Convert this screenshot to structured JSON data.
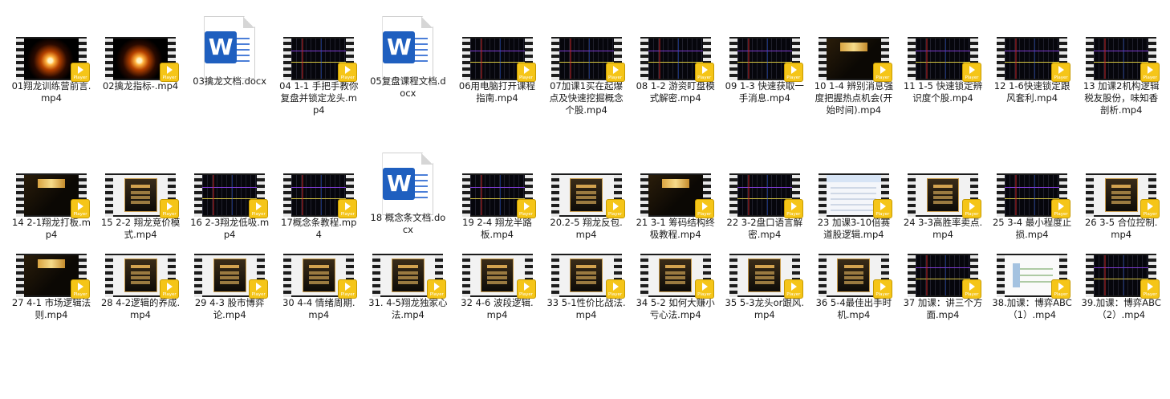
{
  "items": [
    {
      "label": "01翔龙训练营前言.mp4",
      "kind": "video",
      "thumb": "fire"
    },
    {
      "label": "02擒龙指标-.mp4",
      "kind": "video",
      "thumb": "fire"
    },
    {
      "label": "03擒龙文档.docx",
      "kind": "doc",
      "thumb": "word-icon"
    },
    {
      "label": "04 1-1 手把手教你复盘并锁定龙头.mp4",
      "kind": "video",
      "thumb": "chart"
    },
    {
      "label": "05复盘课程文档.docx",
      "kind": "doc",
      "thumb": "word-icon"
    },
    {
      "label": "06用电脑打开课程指南.mp4",
      "kind": "video",
      "thumb": "chart"
    },
    {
      "label": "07加课1买在起爆点及快速挖掘概念个股.mp4",
      "kind": "video",
      "thumb": "chart"
    },
    {
      "label": "08 1-2 游资盯盘模式解密.mp4",
      "kind": "video",
      "thumb": "chart"
    },
    {
      "label": "09 1-3 快速获取一手消息.mp4",
      "kind": "video",
      "thumb": "chart"
    },
    {
      "label": "10 1-4 辨别消息强度把握热点机会(开始时间).mp4",
      "kind": "video",
      "thumb": "cover"
    },
    {
      "label": "11 1-5 快速锁定辨识度个股.mp4",
      "kind": "video",
      "thumb": "chart"
    },
    {
      "label": "12 1-6快速锁定跟风套利.mp4",
      "kind": "video",
      "thumb": "chart"
    },
    {
      "label": "13 加课2机构逻辑税友股份，味知香剖析.mp4",
      "kind": "video",
      "thumb": "chart"
    },
    {
      "label": "14 2-1翔龙打板.mp4",
      "kind": "video",
      "thumb": "cover"
    },
    {
      "label": "15 2-2 翔龙竞价模式.mp4",
      "kind": "video",
      "thumb": "slide"
    },
    {
      "label": "16 2-3翔龙低吸.mp4",
      "kind": "video",
      "thumb": "chart"
    },
    {
      "label": "17概念条教程.mp4",
      "kind": "video",
      "thumb": "chart"
    },
    {
      "label": "18 概念条文档.docx",
      "kind": "doc",
      "thumb": "word-icon"
    },
    {
      "label": "19 2-4 翔龙半路板.mp4",
      "kind": "video",
      "thumb": "chart"
    },
    {
      "label": "20.2-5 翔龙反包.mp4",
      "kind": "video",
      "thumb": "slide"
    },
    {
      "label": "21 3-1 筹码结构终极教程.mp4",
      "kind": "video",
      "thumb": "cover"
    },
    {
      "label": "22 3-2盘口语言解密.mp4",
      "kind": "video",
      "thumb": "chart"
    },
    {
      "label": "23 加课3-10倍赛道股逻辑.mp4",
      "kind": "video",
      "thumb": "ui"
    },
    {
      "label": "24 3-3高胜率卖点.mp4",
      "kind": "video",
      "thumb": "slide"
    },
    {
      "label": "25 3-4 最小程度止损.mp4",
      "kind": "video",
      "thumb": "chart"
    },
    {
      "label": "26 3-5 合位控制.mp4",
      "kind": "video",
      "thumb": "slide"
    },
    {
      "label": "27 4-1 市场逻辑法则.mp4",
      "kind": "video",
      "thumb": "cover"
    },
    {
      "label": "28 4-2逻辑的养成.mp4",
      "kind": "video",
      "thumb": "slide"
    },
    {
      "label": "29 4-3 股市博弈论.mp4",
      "kind": "video",
      "thumb": "slide"
    },
    {
      "label": "30 4-4 情绪周期.mp4",
      "kind": "video",
      "thumb": "slide"
    },
    {
      "label": "31. 4-5翔龙独家心法.mp4",
      "kind": "video",
      "thumb": "slide"
    },
    {
      "label": "32 4-6 波段逻辑.mp4",
      "kind": "video",
      "thumb": "slide"
    },
    {
      "label": "33 5-1性价比战法.mp4",
      "kind": "video",
      "thumb": "slide"
    },
    {
      "label": "34 5-2 如何大赚小亏心法.mp4",
      "kind": "video",
      "thumb": "slide"
    },
    {
      "label": "35 5-3龙头or跟风.mp4",
      "kind": "video",
      "thumb": "slide"
    },
    {
      "label": "36 5-4最佳出手时机.mp4",
      "kind": "video",
      "thumb": "slide"
    },
    {
      "label": "37 加课：讲三个方面.mp4",
      "kind": "video",
      "thumb": "chart"
    },
    {
      "label": "38.加课：博弈ABC（1）.mp4",
      "kind": "video",
      "thumb": "mind"
    },
    {
      "label": "39.加课：博弈ABC（2）.mp4",
      "kind": "video",
      "thumb": "chart"
    }
  ],
  "badge_text": "Player",
  "word_letter": "W"
}
